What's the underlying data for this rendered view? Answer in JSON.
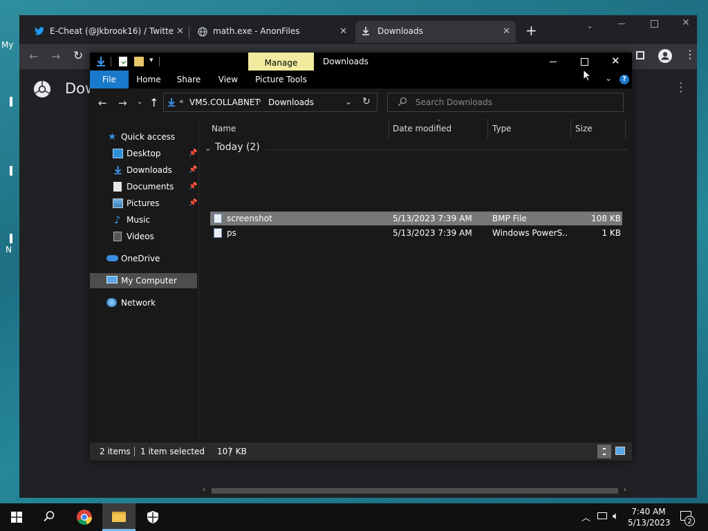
{
  "desktop": {
    "partial_labels": [
      "My",
      "N"
    ]
  },
  "chrome": {
    "tabs": [
      {
        "title": "E-Cheat (@Jkbrook16) / Twitter",
        "icon": "twitter-icon",
        "close": "✕"
      },
      {
        "title": "math.exe - AnonFiles",
        "icon": "globe-icon",
        "close": "✕"
      },
      {
        "title": "Downloads",
        "icon": "download-icon",
        "close": "✕"
      }
    ],
    "new_tab": "+",
    "page_title": "Dow"
  },
  "explorer": {
    "title": "Downloads",
    "context_tab": "Manage",
    "ribbon_tabs": [
      "File",
      "Home",
      "Share",
      "View",
      "Picture Tools"
    ],
    "address": {
      "overflow": "«",
      "crumbs": [
        "VM5.COLLABNET",
        "Downloads"
      ]
    },
    "search_placeholder": "Search Downloads",
    "nav": {
      "quick_access": "Quick access",
      "pinned": [
        {
          "label": "Desktop",
          "icon": "desktop-folder-icon",
          "pinned": true
        },
        {
          "label": "Downloads",
          "icon": "downloads-folder-icon",
          "pinned": true
        },
        {
          "label": "Documents",
          "icon": "documents-folder-icon",
          "pinned": true
        },
        {
          "label": "Pictures",
          "icon": "pictures-folder-icon",
          "pinned": true
        },
        {
          "label": "Music",
          "icon": "music-folder-icon",
          "pinned": false
        },
        {
          "label": "Videos",
          "icon": "videos-folder-icon",
          "pinned": false
        }
      ],
      "onedrive": "OneDrive",
      "my_computer": "My Computer",
      "network": "Network"
    },
    "columns": [
      "Name",
      "Date modified",
      "Type",
      "Size"
    ],
    "group_label": "Today (2)",
    "files": [
      {
        "name": "screenshot",
        "date": "5/13/2023 7:39 AM",
        "type": "BMP File",
        "size": "108 KB",
        "selected": true
      },
      {
        "name": "ps",
        "date": "5/13/2023 7:39 AM",
        "type": "Windows PowerS...",
        "size": "1 KB",
        "selected": false
      }
    ],
    "status": {
      "items": "2 items",
      "selection": "1 item selected",
      "selection_size": "107 KB"
    }
  },
  "taskbar": {
    "time": "7:40 AM",
    "date": "5/13/2023",
    "notification_count": "2"
  },
  "colors": {
    "accent": "#1a73e8",
    "manage_tab": "#f1eba0",
    "file_tab": "#1979ca",
    "selected_row": "#777777"
  }
}
